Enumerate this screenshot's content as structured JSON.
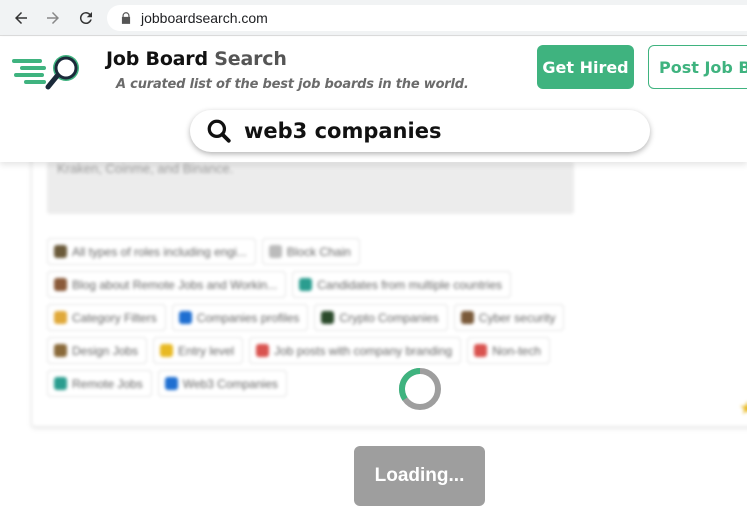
{
  "browser": {
    "url": "jobboardsearch.com"
  },
  "header": {
    "brand_main": "Job Board",
    "brand_accent": "Search",
    "tagline": "A curated list of the best job boards in the world.",
    "get_hired_label": "Get Hired",
    "post_job_label": "Post Job Bo",
    "search_query": "web3 companies",
    "accent_color": "#3fb37f"
  },
  "card": {
    "description": "Kraken, Coinme, and Binance.",
    "tag_rows": [
      [
        {
          "label": "All types of roles including engi...",
          "icon_color": "#6b5a3a"
        },
        {
          "label": "Block Chain",
          "icon_color": "#bbbbbb"
        }
      ],
      [
        {
          "label": "Blog about Remote Jobs and Workin...",
          "icon_color": "#8a5a3a"
        },
        {
          "label": "Candidates from multiple countries",
          "icon_color": "#2a9d8f"
        }
      ],
      [
        {
          "label": "Category Filters",
          "icon_color": "#e0a93a"
        },
        {
          "label": "Companies profiles",
          "icon_color": "#1f6fd1"
        },
        {
          "label": "Crypto Companies",
          "icon_color": "#2b4a2b"
        },
        {
          "label": "Cyber security",
          "icon_color": "#7a5a3a"
        }
      ],
      [
        {
          "label": "Design Jobs",
          "icon_color": "#8a6a3a"
        },
        {
          "label": "Entry level",
          "icon_color": "#e8b923"
        },
        {
          "label": "Job posts with company branding",
          "icon_color": "#d9534f"
        },
        {
          "label": "Non-tech",
          "icon_color": "#d9534f"
        }
      ],
      [
        {
          "label": "Remote Jobs",
          "icon_color": "#2a9d8f"
        },
        {
          "label": "Web3 Companies",
          "icon_color": "#1f6fd1"
        }
      ]
    ]
  },
  "overlay": {
    "loading_label": "Loading..."
  }
}
